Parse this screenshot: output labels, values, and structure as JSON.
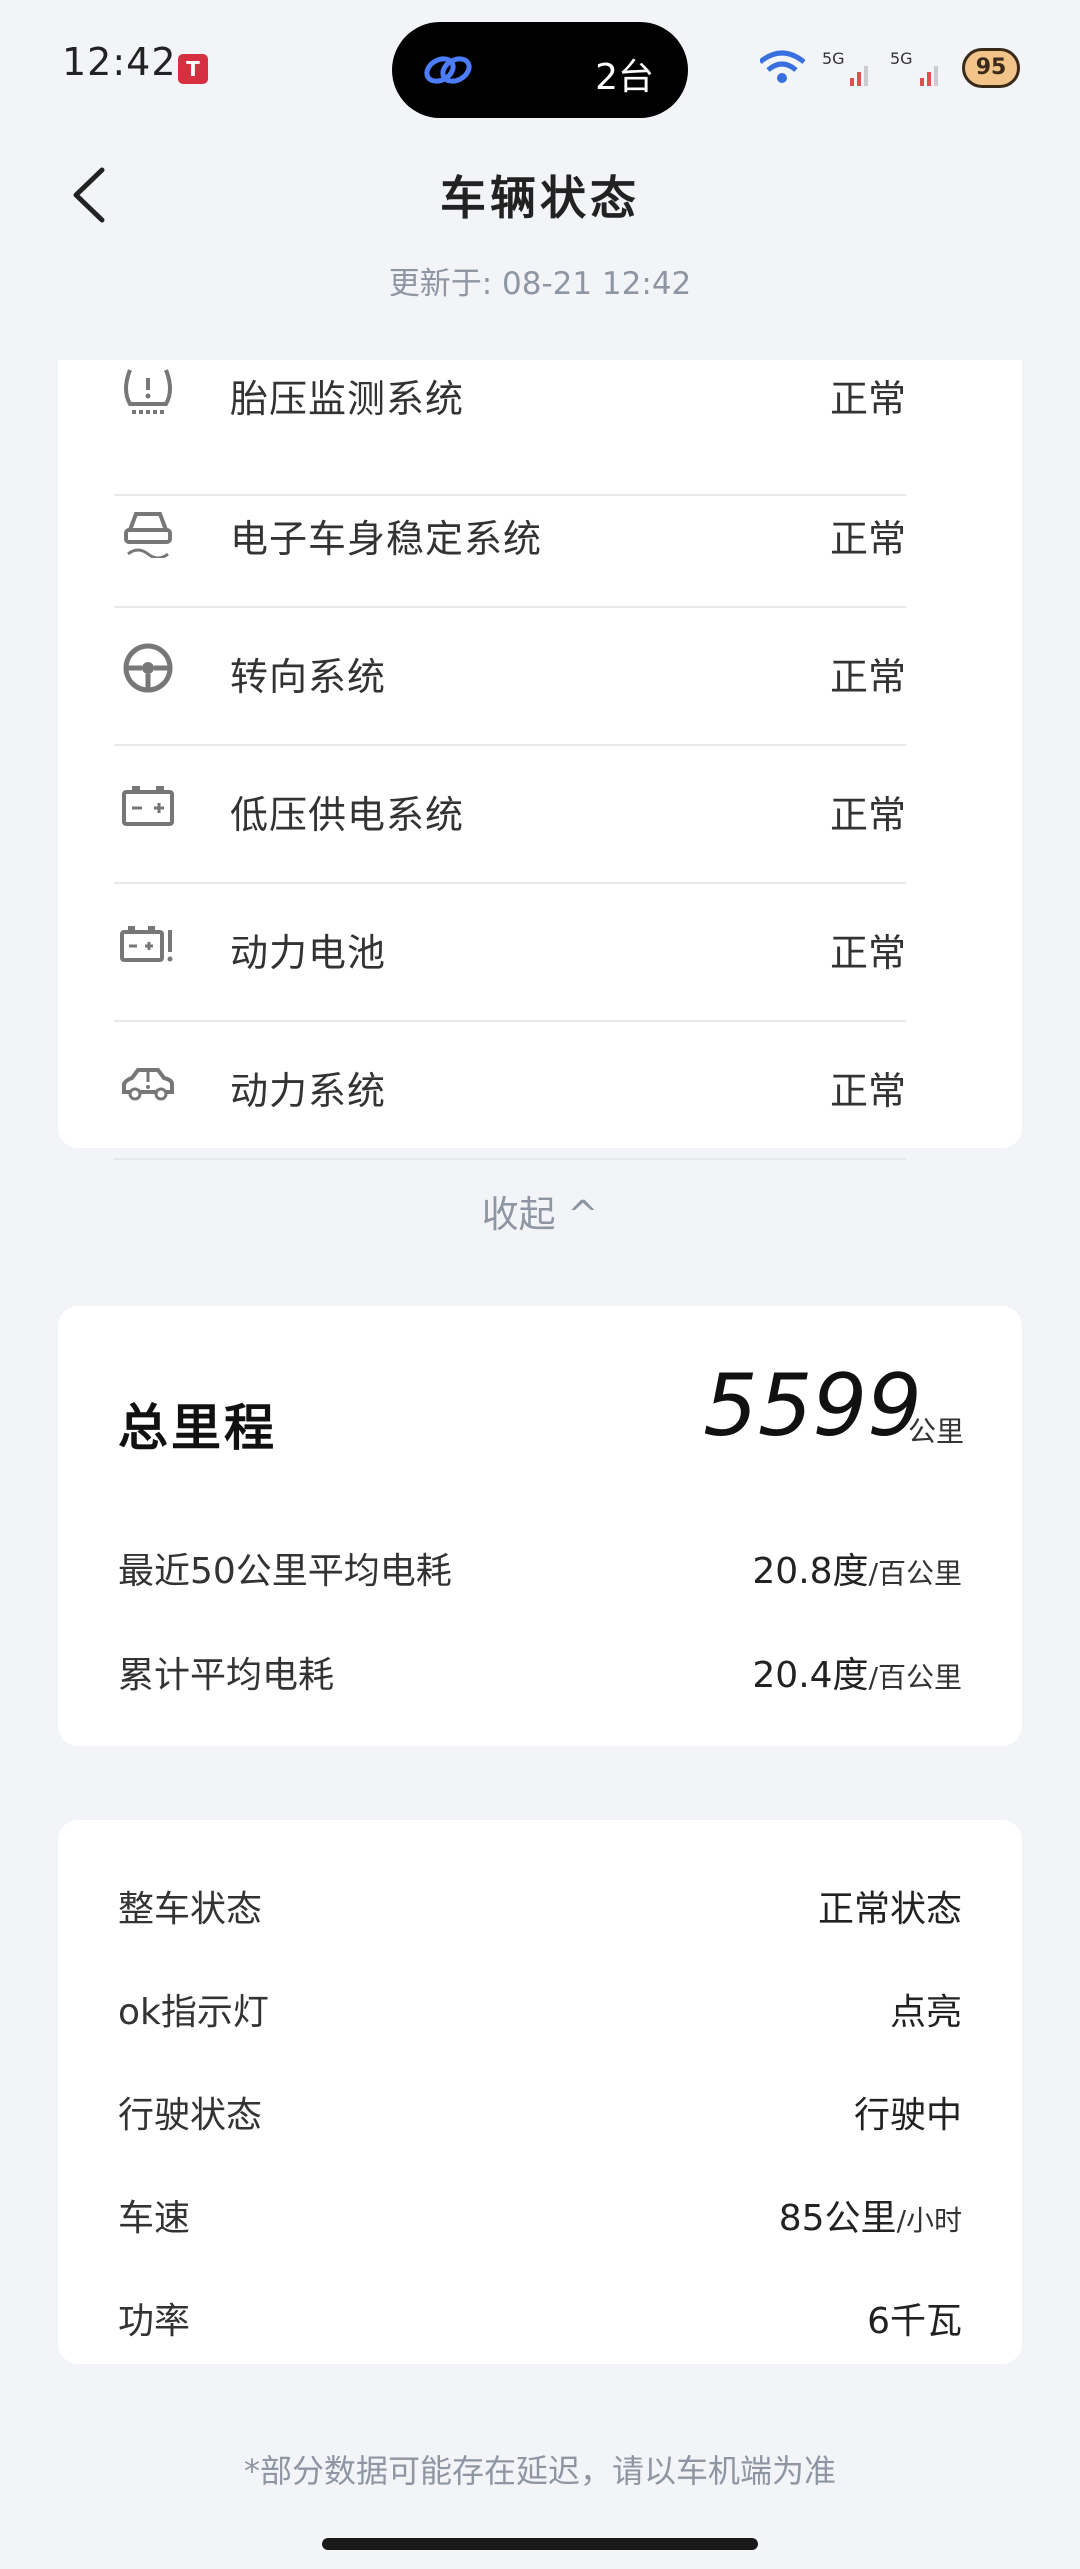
{
  "status_bar": {
    "time": "12:42",
    "island_text": "2台",
    "battery_text": "95"
  },
  "header": {
    "title": "车辆状态",
    "update_time": "更新于: 08-21 12:42"
  },
  "systems": [
    {
      "icon": "tire-pressure-icon",
      "label": "胎压监测系统",
      "status": "正常"
    },
    {
      "icon": "stability-control-icon",
      "label": "电子车身稳定系统",
      "status": "正常"
    },
    {
      "icon": "steering-wheel-icon",
      "label": "转向系统",
      "status": "正常"
    },
    {
      "icon": "battery-icon",
      "label": "低压供电系统",
      "status": "正常"
    },
    {
      "icon": "battery-warning-icon",
      "label": "动力电池",
      "status": "正常"
    },
    {
      "icon": "car-warning-icon",
      "label": "动力系统",
      "status": "正常"
    }
  ],
  "collapse_label": "收起 ^",
  "mileage": {
    "title": "总里程",
    "value": "5599",
    "unit": "公里",
    "rows": [
      {
        "label": "最近50公里平均电耗",
        "value": "20.8度",
        "unit": "/百公里"
      },
      {
        "label": "累计平均电耗",
        "value": "20.4度",
        "unit": "/百公里"
      }
    ]
  },
  "vehicle_state": [
    {
      "label": "整车状态",
      "value": "正常状态",
      "unit": ""
    },
    {
      "label": "ok指示灯",
      "value": "点亮",
      "unit": ""
    },
    {
      "label": "行驶状态",
      "value": "行驶中",
      "unit": ""
    },
    {
      "label": "车速",
      "value": "85公里",
      "unit": "/小时"
    },
    {
      "label": "功率",
      "value": "6千瓦",
      "unit": ""
    }
  ],
  "footnote": "*部分数据可能存在延迟，请以车机端为准"
}
